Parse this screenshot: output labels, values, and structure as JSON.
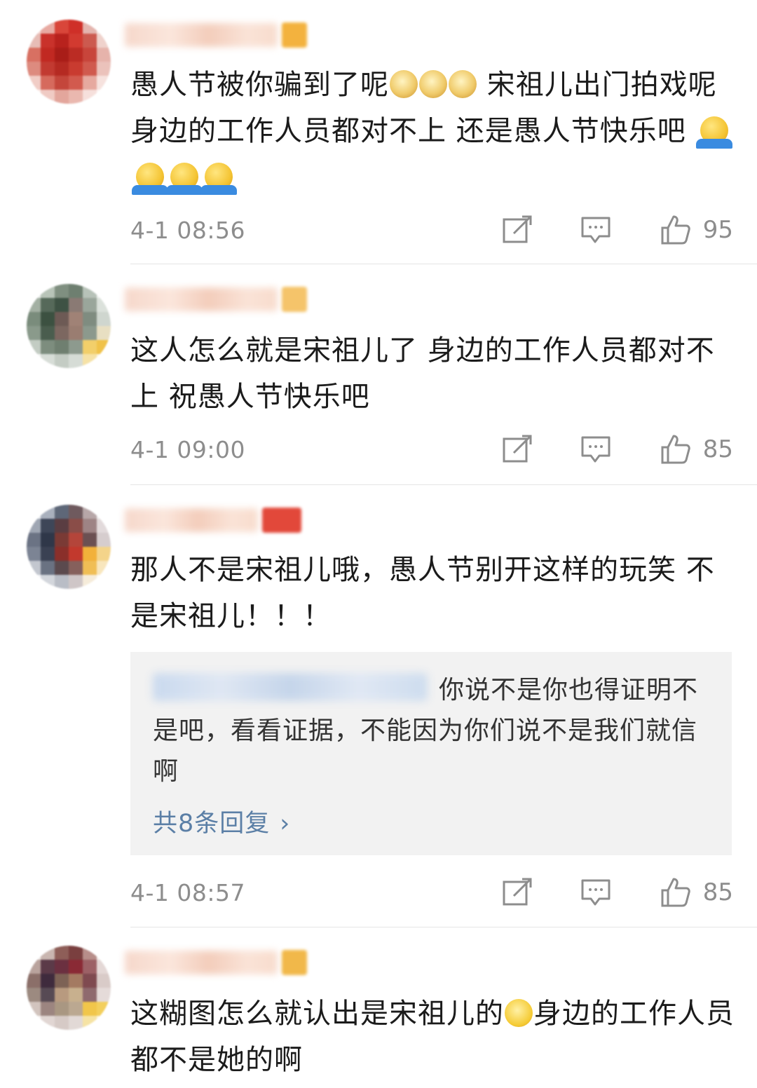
{
  "comments": [
    {
      "text_before": "愚人节被你骗到了呢",
      "text_after": " 宋祖儿出门拍戏呢 身边的工作人员都对不上 还是愚人节快乐吧",
      "emoji_mid": "doge-emoji",
      "emoji_end": "shrug-emoji",
      "time": "4-1 08:56",
      "likes": "95"
    },
    {
      "text": "这人怎么就是宋祖儿了 身边的工作人员都对不上 祝愚人节快乐吧",
      "time": "4-1 09:00",
      "likes": "85"
    },
    {
      "text": "那人不是宋祖儿哦，愚人节别开这样的玩笑 不是宋祖儿！！！",
      "reply": {
        "text": "你说不是你也得证明不是吧，看看证据，不能因为你们说不是我们就信啊",
        "more": "共8条回复"
      },
      "time": "4-1 08:57",
      "likes": "85"
    },
    {
      "text_before": "这糊图怎么就认出是宋祖儿的",
      "text_after": "身边的工作人员都不是她的啊",
      "emoji_mid": "smirk-emoji"
    }
  ],
  "icons": {
    "share": "share-icon",
    "comment": "comment-icon",
    "like": "thumbs-up-icon"
  },
  "colors": {
    "text": "#1b1b1b",
    "meta": "#8d8d8d",
    "link": "#5b7fa6",
    "reply_bg": "#f2f2f2",
    "divider": "#e5e5e5"
  }
}
